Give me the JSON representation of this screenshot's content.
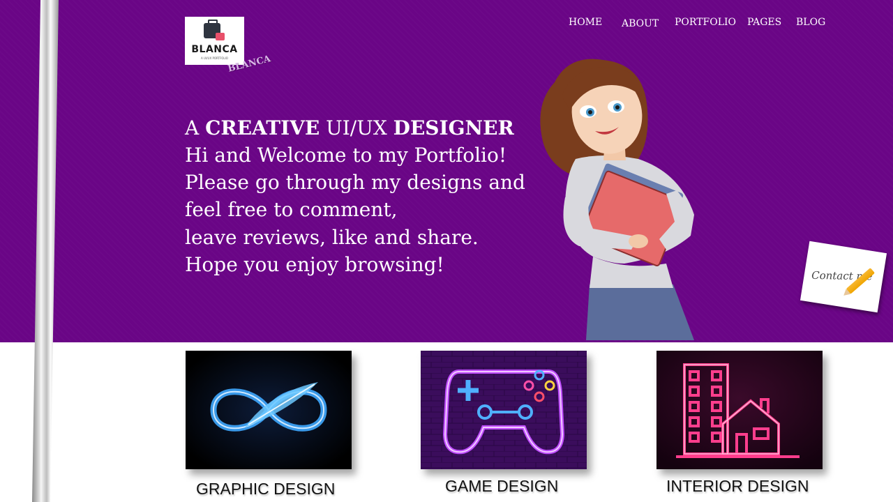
{
  "brand": {
    "logo_text": "BLANCA",
    "logo_subtext": "A UI/UX PORTFOLIO",
    "wordmark": "BLANCA"
  },
  "nav": {
    "items": [
      {
        "label": "HOME"
      },
      {
        "label": "ABOUT"
      },
      {
        "label": "PORTFOLIO"
      },
      {
        "label": "PAGES"
      },
      {
        "label": "BLOG"
      }
    ]
  },
  "hero": {
    "headline": {
      "prefix": "A",
      "word1": "CREATIVE",
      "middle": "UI/UX",
      "word2": "DESIGNER"
    },
    "intro_lines": [
      "Hi and Welcome to my Portfolio!",
      "Please go through my designs and",
      "feel free to comment,",
      "leave reviews, like and share.",
      "Hope you enjoy browsing!"
    ],
    "contact_card_text": "Contact me"
  },
  "categories": [
    {
      "label": "GRAPHIC DESIGN",
      "icon": "infinity-feather-icon"
    },
    {
      "label": "GAME DESIGN",
      "icon": "gamepad-neon-icon"
    },
    {
      "label": "INTERIOR DESIGN",
      "icon": "building-house-neon-icon"
    }
  ],
  "colors": {
    "hero_background": "#6a0586",
    "text_light": "#ffffff",
    "wordmark": "#d8b7e6",
    "neon_blue": "#3fa9ff",
    "neon_purple": "#c04dff",
    "neon_pink": "#ff3e8d"
  }
}
